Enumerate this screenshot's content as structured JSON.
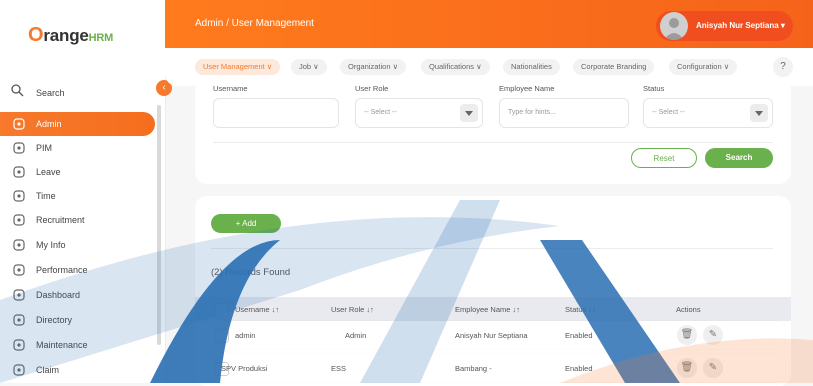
{
  "brand": {
    "logo_o": "O",
    "logo_range": "range",
    "logo_hrm": "HRM"
  },
  "sidebar": {
    "search_label": "Search",
    "items": [
      {
        "label": "Admin",
        "icon": "admin-icon",
        "active": true
      },
      {
        "label": "PIM",
        "icon": "pim-icon"
      },
      {
        "label": "Leave",
        "icon": "leave-icon"
      },
      {
        "label": "Time",
        "icon": "time-icon"
      },
      {
        "label": "Recruitment",
        "icon": "recruitment-icon"
      },
      {
        "label": "My Info",
        "icon": "myinfo-icon"
      },
      {
        "label": "Performance",
        "icon": "performance-icon"
      },
      {
        "label": "Dashboard",
        "icon": "dashboard-icon"
      },
      {
        "label": "Directory",
        "icon": "directory-icon"
      },
      {
        "label": "Maintenance",
        "icon": "maintenance-icon"
      },
      {
        "label": "Claim",
        "icon": "claim-icon"
      }
    ]
  },
  "header": {
    "breadcrumb": "Admin / User Management",
    "user_name": "Anisyah Nur Septiana ▾"
  },
  "topbar": {
    "tabs": [
      {
        "label": "User Management ∨",
        "active": true
      },
      {
        "label": "Job ∨"
      },
      {
        "label": "Organization ∨"
      },
      {
        "label": "Qualifications ∨"
      },
      {
        "label": "Nationalities"
      },
      {
        "label": "Corporate Branding"
      },
      {
        "label": "Configuration ∨"
      }
    ],
    "help": "?"
  },
  "filters": {
    "username_label": "Username",
    "user_role_label": "User Role",
    "user_role_value": "-- Select --",
    "employee_name_label": "Employee Name",
    "employee_name_placeholder": "Type for hints...",
    "status_label": "Status",
    "status_value": "-- Select --",
    "reset": "Reset",
    "search": "Search"
  },
  "records": {
    "add": "+ Add",
    "found": "(2) Records Found",
    "columns": [
      "Username ↓↑",
      "User Role ↓↑",
      "Employee Name ↓↑",
      "Status ↓↑",
      "Actions"
    ],
    "rows": [
      [
        "admin",
        "Admin",
        "Anisyah Nur Septiana",
        "Enabled"
      ],
      [
        "SPV Produksi",
        "ESS",
        "Bambang -",
        "Enabled"
      ]
    ]
  },
  "colors": {
    "accent": "#f7792c",
    "green": "#6ab04c"
  }
}
